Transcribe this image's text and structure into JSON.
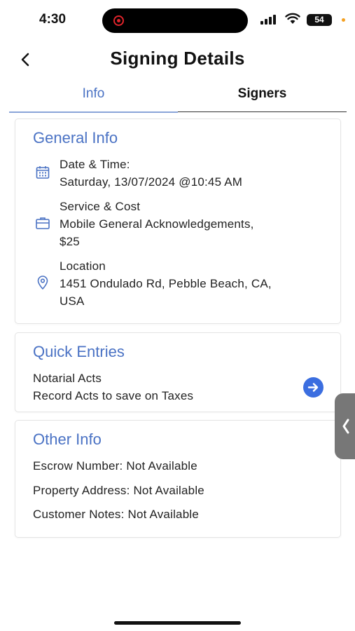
{
  "status_bar": {
    "time": "4:30",
    "battery": "54"
  },
  "header": {
    "title": "Signing Details"
  },
  "tabs": [
    {
      "label": "Info",
      "active": true
    },
    {
      "label": "Signers",
      "active": false
    }
  ],
  "general_info": {
    "title": "General Info",
    "date_time_label": "Date & Time:",
    "date_time_value": "Saturday, 13/07/2024 @10:45 AM",
    "service_label": "Service & Cost",
    "service_value_line1": "Mobile General Acknowledgements,",
    "service_value_line2": "$25",
    "location_label": "Location",
    "location_value_line1": "1451 Ondulado Rd, Pebble Beach, CA,",
    "location_value_line2": "USA"
  },
  "quick_entries": {
    "title": "Quick Entries",
    "line1": "Notarial Acts",
    "line2": "Record Acts to save on Taxes"
  },
  "other_info": {
    "title": "Other Info",
    "escrow": "Escrow Number: Not Available",
    "property": "Property Address: Not Available",
    "notes": "Customer Notes: Not Available"
  },
  "icons": {
    "back": "chevron-left-icon",
    "date": "calendar-icon",
    "service": "briefcase-icon",
    "location": "map-pin-icon",
    "quick_entry_action": "arrow-right-circle-icon",
    "side_handle": "chevron-left-icon"
  },
  "colors": {
    "accent": "#4a72c4",
    "action_button": "#3b6ee0"
  }
}
